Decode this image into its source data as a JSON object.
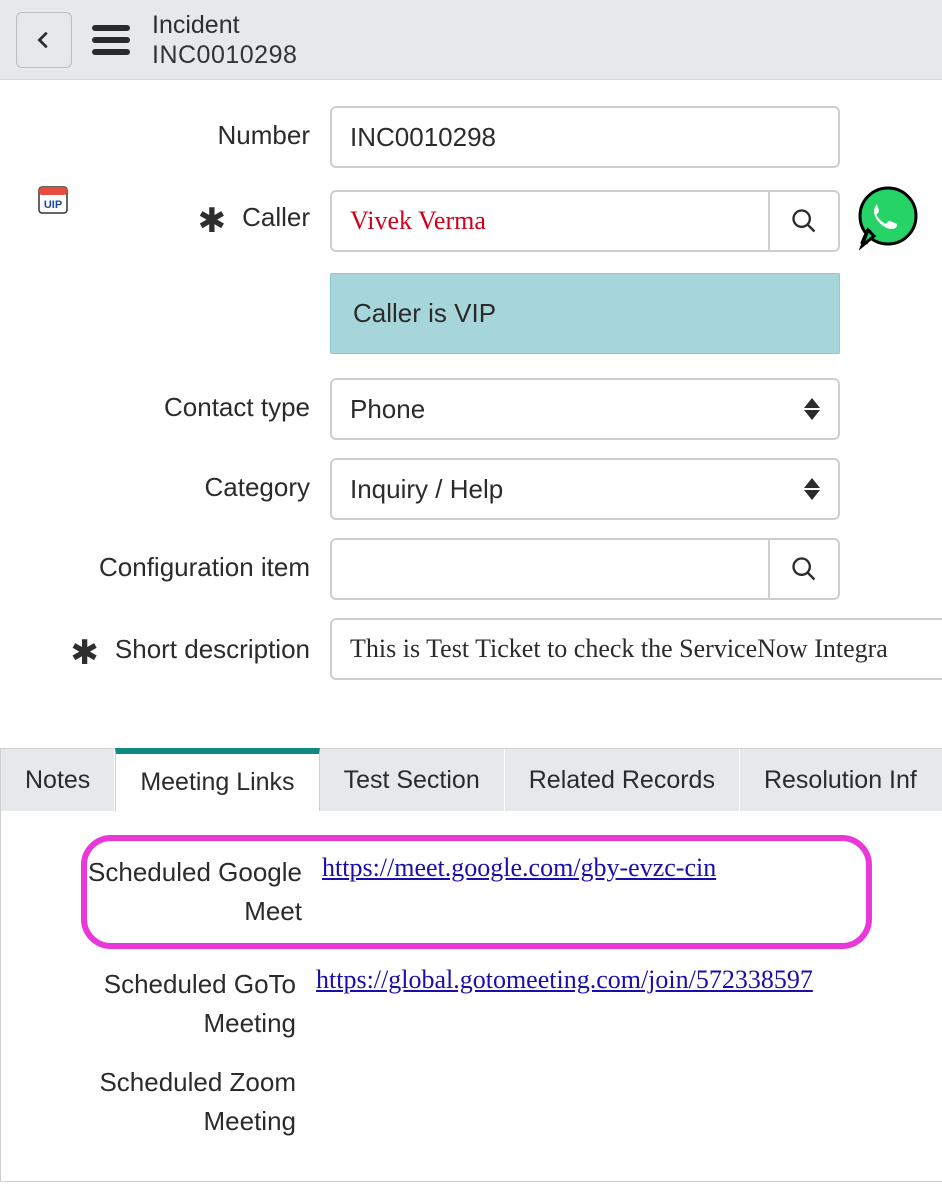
{
  "header": {
    "title": "Incident",
    "subtitle": "INC0010298"
  },
  "form": {
    "number": {
      "label": "Number",
      "value": "INC0010298"
    },
    "caller": {
      "label": "Caller",
      "value": "Vivek Verma",
      "vip_notice": "Caller is VIP"
    },
    "contact_type": {
      "label": "Contact type",
      "value": "Phone"
    },
    "category": {
      "label": "Category",
      "value": "Inquiry / Help"
    },
    "configuration_item": {
      "label": "Configuration item",
      "value": ""
    },
    "short_description": {
      "label": "Short description",
      "value": "This is Test Ticket to check the ServiceNow Integra"
    }
  },
  "tabs": {
    "notes": "Notes",
    "meeting_links": "Meeting Links",
    "test_section": "Test Section",
    "related_records": "Related Records",
    "resolution_info": "Resolution Inf"
  },
  "meetings": {
    "google": {
      "label": "Scheduled Google Meet",
      "url": "https://meet.google.com/gby-evzc-cin"
    },
    "goto": {
      "label": "Scheduled GoTo Meeting",
      "url": "https://global.gotomeeting.com/join/572338597"
    },
    "zoom": {
      "label": "Scheduled Zoom Meeting",
      "url": ""
    }
  }
}
